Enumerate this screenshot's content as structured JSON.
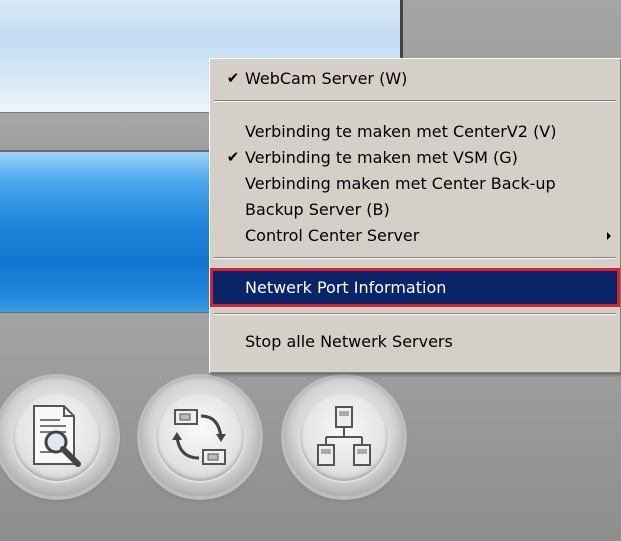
{
  "context_menu": {
    "items": [
      {
        "label": "WebCam Server (W)",
        "checked": true
      },
      {
        "label": "Verbinding te maken met CenterV2 (V)",
        "checked": false
      },
      {
        "label": "Verbinding te maken met VSM (G)",
        "checked": true
      },
      {
        "label": "Verbinding maken met Center Back-up",
        "checked": false
      },
      {
        "label": "Backup Server (B)",
        "checked": false
      },
      {
        "label": "Control Center Server",
        "checked": false,
        "submenu": true
      },
      {
        "label": "Netwerk Port Information",
        "highlighted": true
      },
      {
        "label": "Stop alle Netwerk Servers",
        "checked": false
      }
    ],
    "check_glyph": "✔"
  },
  "toolbar_buttons": [
    {
      "icon": "document-search-icon"
    },
    {
      "icon": "sync-transfer-icon"
    },
    {
      "icon": "network-icon"
    }
  ],
  "colors": {
    "menu_background": "#d4d0c8",
    "highlight_background": "#0a246a",
    "highlight_outline": "#d9212e",
    "blue_bar": "#1176d0"
  }
}
